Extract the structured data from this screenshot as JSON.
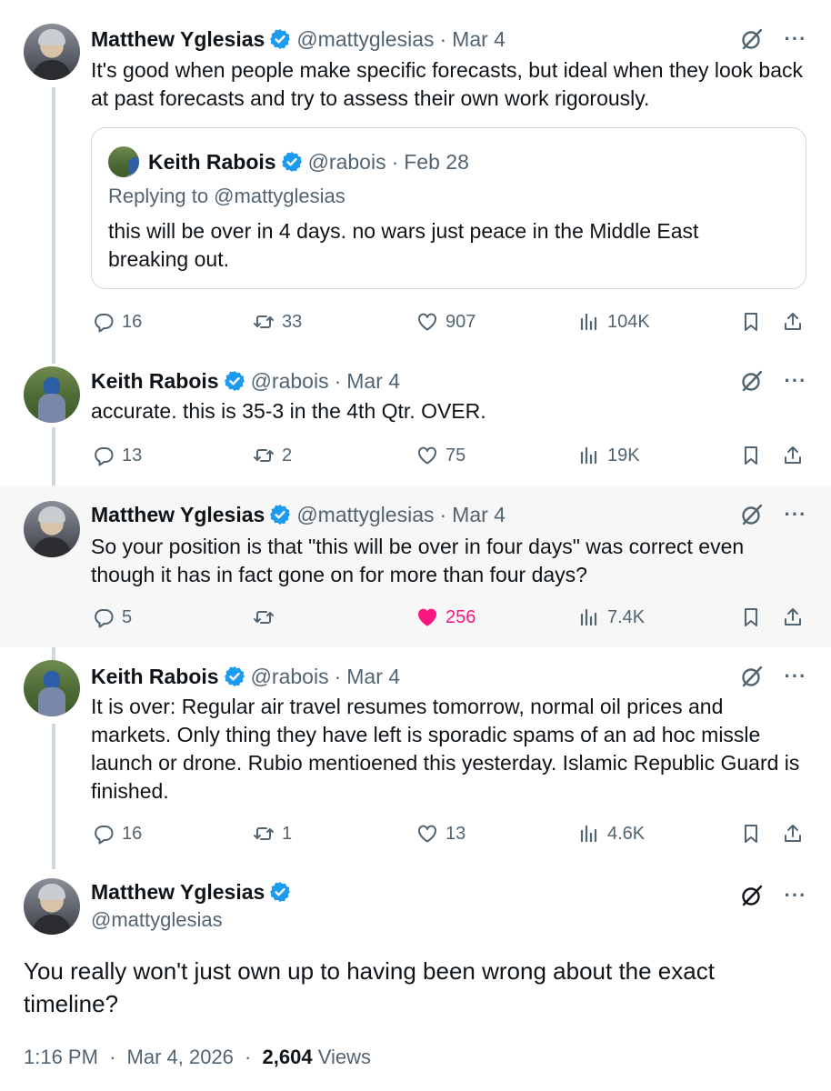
{
  "colors": {
    "verified": "#1d9bf0",
    "secondary_text": "#536471",
    "like_active": "#f91880",
    "thread_line": "#cfd9de"
  },
  "tweets": [
    {
      "name": "Matthew Yglesias",
      "handle": "@mattyglesias",
      "sep": "·",
      "date": "Mar 4",
      "text": "It's good when people make specific forecasts, but ideal when they look back at past forecasts and try to assess their own work rigorously.",
      "quote": {
        "name": "Keith Rabois",
        "handle": "@rabois",
        "sep": "·",
        "date": "Feb 28",
        "replying": "Replying to @mattyglesias",
        "text": "this will be over in 4 days.  no wars just peace in the Middle East breaking out."
      },
      "replies": "16",
      "retweets": "33",
      "likes": "907",
      "views": "104K"
    },
    {
      "name": "Keith Rabois",
      "handle": "@rabois",
      "sep": "·",
      "date": "Mar 4",
      "text": "accurate.  this is 35-3 in the 4th Qtr.  OVER.",
      "replies": "13",
      "retweets": "2",
      "likes": "75",
      "views": "19K"
    },
    {
      "name": "Matthew Yglesias",
      "handle": "@mattyglesias",
      "sep": "·",
      "date": "Mar 4",
      "text": "So your position is that \"this will be over in four days\" was correct even though it has in fact gone on for more than four days?",
      "replies": "5",
      "retweets": "",
      "likes": "256",
      "views": "7.4K",
      "liked": true
    },
    {
      "name": "Keith Rabois",
      "handle": "@rabois",
      "sep": "·",
      "date": "Mar 4",
      "text": "It is over:  Regular air travel resumes tomorrow, normal oil prices and markets.  Only thing they have left is sporadic spams of an ad hoc missle launch or drone.  Rubio mentioened this yesterday.  Islamic Republic Guard is finished.",
      "replies": "16",
      "retweets": "1",
      "likes": "13",
      "views": "4.6K"
    }
  ],
  "main_tweet": {
    "name": "Matthew Yglesias",
    "handle": "@mattyglesias",
    "text": "You really won't just own up to having been wrong about the exact timeline?",
    "time": "1:16 PM",
    "sep1": "·",
    "date": "Mar 4, 2026",
    "sep2": "·",
    "views_count": "2,604",
    "views_label": "Views"
  },
  "icons": {
    "verified": "verified-badge-icon",
    "grok": "grok-icon",
    "more": "more-icon",
    "reply": "reply-icon",
    "retweet": "retweet-icon",
    "like": "heart-icon",
    "views": "views-icon",
    "bookmark": "bookmark-icon",
    "share": "share-icon"
  }
}
